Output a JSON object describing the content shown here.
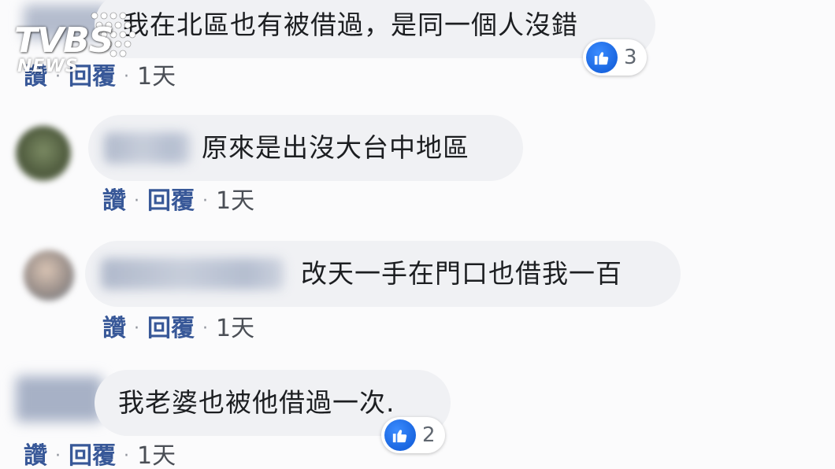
{
  "watermark": {
    "main": "TVBS",
    "sub": "NEWS"
  },
  "comments": [
    {
      "text": "我在北區也有被借過，是同一個人沒錯",
      "like_label": "讚",
      "reply_label": "回覆",
      "time": "1天",
      "reaction_count": "3"
    },
    {
      "text": "原來是出沒大台中地區",
      "like_label": "讚",
      "reply_label": "回覆",
      "time": "1天"
    },
    {
      "text": "改天一手在門口也借我一百",
      "like_label": "讚",
      "reply_label": "回覆",
      "time": "1天"
    },
    {
      "text": "我老婆也被他借過一次.",
      "like_label": "讚",
      "reply_label": "回覆",
      "time": "1天",
      "reaction_count": "2"
    }
  ],
  "colors": {
    "link": "#385898",
    "bubble": "#f0f1f4",
    "like_blue": "#1a66e0"
  }
}
